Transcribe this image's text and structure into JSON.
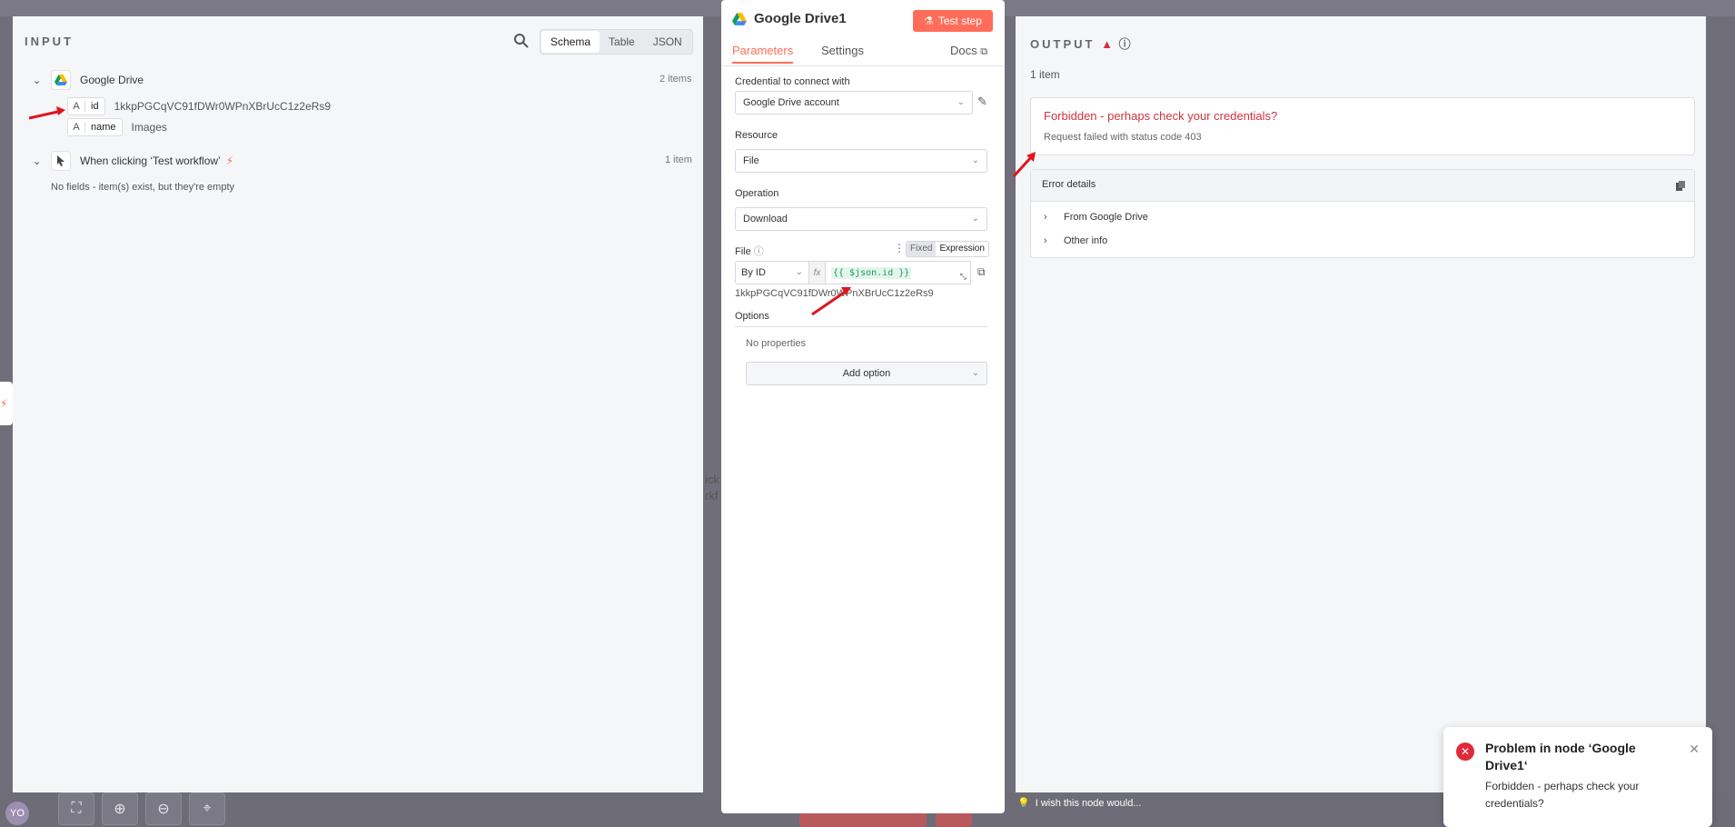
{
  "input_panel": {
    "title": "INPUT",
    "view_tabs": [
      "Schema",
      "Table",
      "JSON"
    ],
    "nodes": [
      {
        "name": "Google Drive",
        "count": "2 items",
        "fields": [
          {
            "type": "A",
            "key": "id",
            "value": "1kkpPGCqVC91fDWr0WPnXBrUcC1z2eRs9"
          },
          {
            "type": "A",
            "key": "name",
            "value": "Images"
          }
        ]
      },
      {
        "name": "When clicking ‘Test workflow’",
        "count": "1 item",
        "empty_text": "No fields - item(s) exist, but they're empty"
      }
    ]
  },
  "node_panel": {
    "title": "Google Drive1",
    "test_step_label": "Test step",
    "tabs": [
      "Parameters",
      "Settings"
    ],
    "docs_label": "Docs",
    "credential": {
      "label": "Credential to connect with",
      "value": "Google Drive account"
    },
    "resource": {
      "label": "Resource",
      "value": "File"
    },
    "operation": {
      "label": "Operation",
      "value": "Download"
    },
    "file": {
      "label": "File",
      "mode_fixed": "Fixed",
      "mode_expression": "Expression",
      "by": "By ID",
      "fx": "fx",
      "expression": "{{ $json.id }}",
      "resolved": "1kkpPGCqVC91fDWr0WPnXBrUcC1z2eRs9"
    },
    "options": {
      "title": "Options",
      "empty": "No properties",
      "add_label": "Add option"
    }
  },
  "output_panel": {
    "title": "OUTPUT",
    "items": "1 item",
    "error": {
      "title": "Forbidden - perhaps check your credentials?",
      "message": "Request failed with status code 403"
    },
    "details": {
      "title": "Error details",
      "rows": [
        "From Google Drive",
        "Other info"
      ]
    }
  },
  "wish_text": "I wish this node would...",
  "toast": {
    "title": "Problem in node ‘Google Drive1‘",
    "message": "Forbidden - perhaps check your credentials?"
  },
  "background": {
    "avatar": "YO",
    "ghost_1": "ick",
    "ghost_2": "rkf"
  },
  "colors": {
    "accent": "#ff6d5a",
    "error": "#d2323f",
    "panel": "#f5f6f8",
    "backdrop": "#6f6e79"
  }
}
